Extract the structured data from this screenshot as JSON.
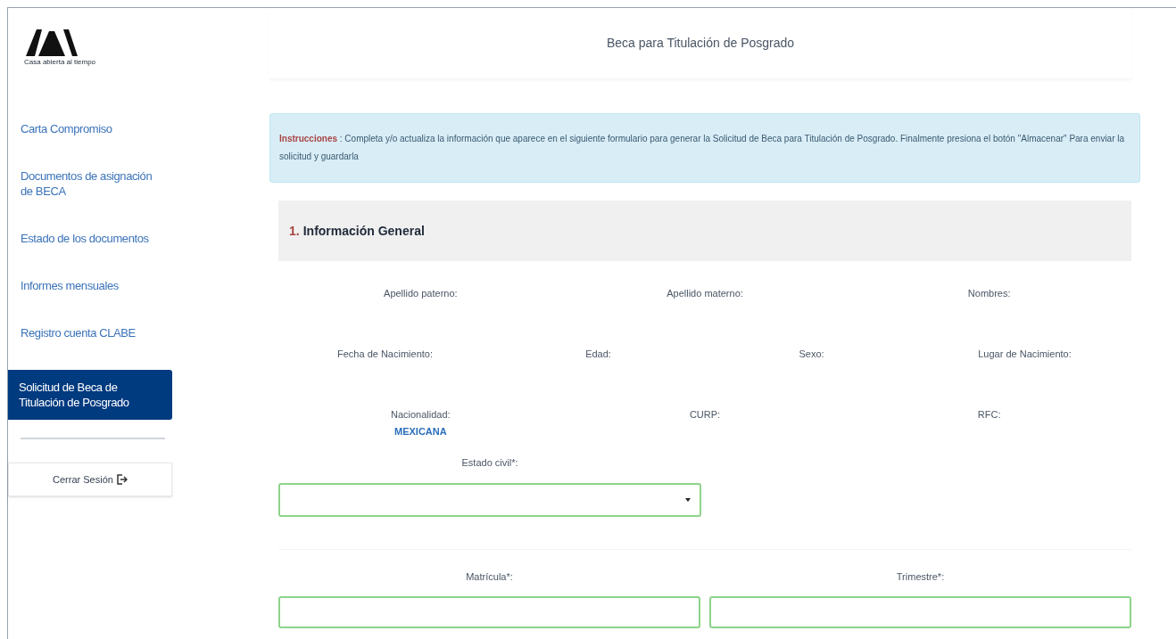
{
  "logo": {
    "tagline": "Casa abierta al tiempo"
  },
  "header": {
    "title": "Beca para Titulación de Posgrado"
  },
  "sidebar": {
    "items": [
      {
        "label": "Carta Compromiso",
        "selected": false
      },
      {
        "label": "Documentos de asignación de BECA",
        "selected": false
      },
      {
        "label": "Estado de los documentos",
        "selected": false
      },
      {
        "label": "Informes mensuales",
        "selected": false
      },
      {
        "label": "Registro cuenta CLABE",
        "selected": false
      },
      {
        "label": "Solicitud de Beca de Titulación de Posgrado",
        "selected": true
      }
    ],
    "logout": "Cerrar Sesión"
  },
  "instructions": {
    "label": "Instrucciones",
    "text": " : Completa y/o actualiza la información que aparece en el siguiente formulario para generar la Solicitud de Beca para Titulación de Posgrado. Finalmente presiona el botón \"Almacenar\" Para enviar la solicitud y guardarla"
  },
  "section": {
    "number": "1.",
    "title": "Información General"
  },
  "info_rows": [
    [
      {
        "label": "Apellido paterno:"
      },
      {
        "label": "Apellido materno:"
      },
      {
        "label": "Nombres:"
      }
    ],
    [
      {
        "label": "Fecha de Nacimiento:"
      },
      {
        "label": "Edad:"
      },
      {
        "label": "Sexo:"
      },
      {
        "label": "Lugar de Nacimiento:"
      }
    ],
    [
      {
        "label": "Nacionalidad:",
        "value": "MEXICANA"
      },
      {
        "label": "CURP:"
      },
      {
        "label": "RFC:"
      }
    ]
  ],
  "estado_civil": {
    "label": "Estado civil*:"
  },
  "fields": [
    {
      "label": "Matrícula*:"
    },
    {
      "label": "Trimestre*:"
    }
  ]
}
